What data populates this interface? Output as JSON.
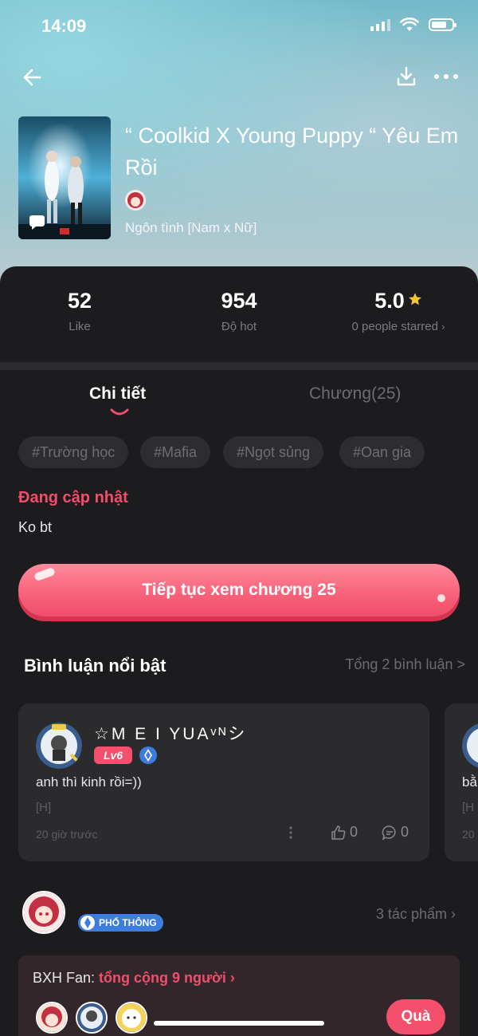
{
  "status_bar": {
    "time": "14:09"
  },
  "story": {
    "title": "“ Coolkid X Young Puppy “ Yêu Em Rồi",
    "genre": "Ngôn tình [Nam x Nữ]"
  },
  "stats": {
    "likes": "52",
    "likes_label": "Like",
    "hot": "954",
    "hot_label": "Độ hot",
    "rating": "5.0",
    "rating_label": "0 people starred",
    "star_color": "#f6c23a"
  },
  "tabs": {
    "details": "Chi tiết",
    "chapters": "Chương(25)"
  },
  "tags": [
    "#Trường học",
    "#Mafia",
    "#Ngọt sủng",
    "#Oan gia"
  ],
  "status": {
    "label": "Đang cập nhật",
    "description": "Ko bt"
  },
  "continue_button": "Tiếp tục xem chương 25",
  "comments": {
    "section_title": "Bình luận nổi bật",
    "total": "Tổng 2 bình luận >",
    "items": [
      {
        "name": "☆M E I YUAᵛᴺシ",
        "level": "Lv6",
        "text": "anh thì kinh rồi=))",
        "tag": "[H]",
        "time": "20 giờ trước",
        "likes": "0",
        "replies": "0"
      },
      {
        "text": "bằ",
        "tag": "[H",
        "time": "20"
      }
    ]
  },
  "author": {
    "rank": "PHỔ THÔNG",
    "works": "3 tác phẩm"
  },
  "fans": {
    "label": "BXH Fan:",
    "count": "tổng cộng 9 người",
    "gift_button": "Quà"
  },
  "colors": {
    "accent": "#f24d6d",
    "panel": "#1c1c1e",
    "card": "#2b2b2d"
  }
}
